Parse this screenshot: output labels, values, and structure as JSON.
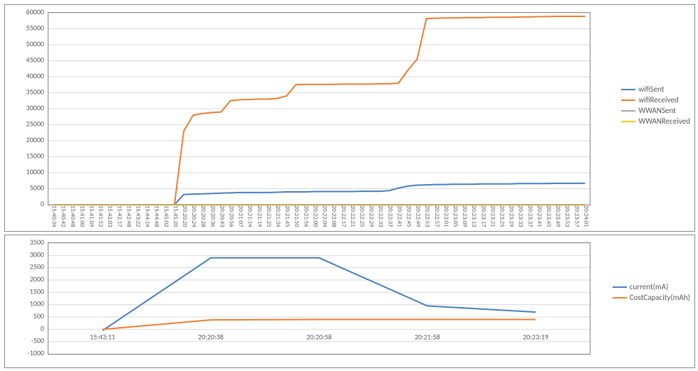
{
  "chart_data": [
    {
      "type": "line",
      "title": "",
      "xlabel": "",
      "ylabel": "",
      "ylim": [
        0,
        60000
      ],
      "yticks": [
        0,
        5000,
        10000,
        15000,
        20000,
        25000,
        30000,
        35000,
        40000,
        45000,
        50000,
        55000,
        60000
      ],
      "x": [
        "15:40:34",
        "15:40:42",
        "15:40:48",
        "15:41:00",
        "15:41:09",
        "15:41:52",
        "15:42:03",
        "15:42:17",
        "15:42:48",
        "15:43:22",
        "15:44:14",
        "15:44:48",
        "15:45:02",
        "15:45:20",
        "20:20:20",
        "20:20:24",
        "20:20:28",
        "20:20:36",
        "20:20:43",
        "20:20:56",
        "20:21:07",
        "20:21:14",
        "20:21:19",
        "20:21:25",
        "20:21:34",
        "20:21:45",
        "20:21:50",
        "20:21:56",
        "20:22:00",
        "20:22:04",
        "20:22:08",
        "20:22:17",
        "20:22:21",
        "20:22:25",
        "20:22:29",
        "20:22:33",
        "20:22:37",
        "20:22:41",
        "20:22:45",
        "20:22:49",
        "20:22:53",
        "20:22:57",
        "20:23:01",
        "20:23:05",
        "20:23:09",
        "20:23:13",
        "20:23:17",
        "20:23:21",
        "20:23:25",
        "20:23:29",
        "20:23:33",
        "20:23:37",
        "20:23:41",
        "20:23:45",
        "20:23:49",
        "20:23:53",
        "20:23:57",
        "20:24:01"
      ],
      "series": [
        {
          "name": "wifiSent",
          "color": "#4A7EBB",
          "values": [
            0,
            0,
            0,
            0,
            0,
            0,
            0,
            0,
            0,
            0,
            0,
            0,
            0,
            0,
            3200,
            3300,
            3400,
            3500,
            3600,
            3700,
            3800,
            3800,
            3800,
            3800,
            3900,
            4000,
            4000,
            4000,
            4100,
            4100,
            4100,
            4100,
            4100,
            4200,
            4200,
            4200,
            4400,
            5200,
            5800,
            6100,
            6200,
            6300,
            6300,
            6400,
            6400,
            6400,
            6500,
            6500,
            6500,
            6500,
            6600,
            6600,
            6600,
            6600,
            6700,
            6700,
            6700,
            6700
          ]
        },
        {
          "name": "wifiReceived",
          "color": "#ED7D31",
          "values": [
            0,
            0,
            0,
            0,
            0,
            0,
            0,
            0,
            0,
            0,
            0,
            0,
            0,
            0,
            23000,
            28000,
            28500,
            28800,
            29000,
            32500,
            32800,
            32900,
            33000,
            33000,
            33200,
            34000,
            37500,
            37600,
            37600,
            37600,
            37600,
            37700,
            37700,
            37700,
            37700,
            37800,
            37800,
            38000,
            42000,
            45500,
            58200,
            58300,
            58400,
            58400,
            58500,
            58500,
            58500,
            58600,
            58600,
            58600,
            58700,
            58700,
            58800,
            58800,
            58900,
            58900,
            58900,
            58900
          ]
        },
        {
          "name": "WWANSent",
          "color": "#A5A5A5",
          "values": [
            0,
            0,
            0,
            0,
            0,
            0,
            0,
            0,
            0,
            0,
            0,
            0,
            0,
            0,
            0,
            0,
            0,
            0,
            0,
            0,
            0,
            0,
            0,
            0,
            0,
            0,
            0,
            0,
            0,
            0,
            0,
            0,
            0,
            0,
            0,
            0,
            0,
            0,
            0,
            0,
            0,
            0,
            0,
            0,
            0,
            0,
            0,
            0,
            0,
            0,
            0,
            0,
            0,
            0,
            0,
            0,
            0,
            0
          ]
        },
        {
          "name": "WWANReceived",
          "color": "#FFC000",
          "values": [
            0,
            0,
            0,
            0,
            0,
            0,
            0,
            0,
            0,
            0,
            0,
            0,
            0,
            0,
            0,
            0,
            0,
            0,
            0,
            0,
            0,
            0,
            0,
            0,
            0,
            0,
            0,
            0,
            0,
            0,
            0,
            0,
            0,
            0,
            0,
            0,
            0,
            0,
            0,
            0,
            0,
            0,
            0,
            0,
            0,
            0,
            0,
            0,
            0,
            0,
            0,
            0,
            0,
            0,
            0,
            0,
            0,
            0
          ]
        }
      ],
      "legend": [
        "wifiSent",
        "wifiReceived",
        "WWANSent",
        "WWANReceived"
      ]
    },
    {
      "type": "line",
      "title": "",
      "xlabel": "",
      "ylabel": "",
      "ylim": [
        -1000,
        3500
      ],
      "yticks": [
        -1000,
        -500,
        0,
        500,
        1000,
        1500,
        2000,
        2500,
        3000,
        3500
      ],
      "x": [
        "15:43:11",
        "20:20:38",
        "20:20:58",
        "20:21:58",
        "20:23:19"
      ],
      "series": [
        {
          "name": "current(mA)",
          "color": "#4A7EBB",
          "values": [
            -50,
            2900,
            2900,
            950,
            700
          ]
        },
        {
          "name": "CostCapacity(mAh)",
          "color": "#ED7D31",
          "values": [
            0,
            380,
            400,
            400,
            400
          ]
        }
      ],
      "legend": [
        "current(mA)",
        "CostCapacity(mAh)"
      ]
    }
  ]
}
